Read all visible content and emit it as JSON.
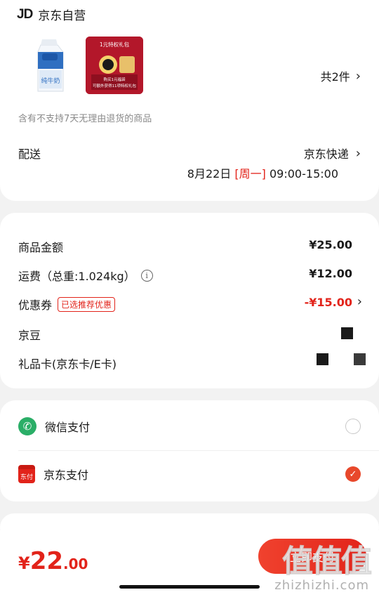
{
  "shop": {
    "logo": "JD",
    "name": "京东自营"
  },
  "items": {
    "thumbnails": [
      {
        "icon": "milk-carton-image",
        "label": "纯牛奶"
      },
      {
        "icon": "gift-pack-image",
        "title": "1元特权礼包",
        "line1": "购买1元福袋",
        "line2": "可额外获得11项特权礼包"
      }
    ],
    "count_label": "共2件",
    "return_note": "含有不支持7天无理由退货的商品"
  },
  "delivery": {
    "label": "配送",
    "method": "京东快递",
    "date": "8月22日",
    "weekday": "[周一]",
    "time": "09:00-15:00"
  },
  "price": {
    "goods_label": "商品金额",
    "goods_value": "¥25.00",
    "shipping_label": "运费（总重:1.024kg）",
    "shipping_value": "¥12.00",
    "coupon_label": "优惠券",
    "coupon_tag": "已选推荐优惠",
    "coupon_value": "-¥15.00",
    "jingdou_label": "京豆",
    "giftcard_label": "礼品卡(京东卡/E卡)"
  },
  "payment": {
    "wechat_label": "微信支付",
    "jdpay_label": "京东支付",
    "jdpay_icon_text": "东付",
    "selected": "京东支付"
  },
  "bottom": {
    "currency": "¥",
    "total_int": "22",
    "total_dec": ".00",
    "pay_button": "立即支付",
    "watermark": "值值值",
    "watermark_url": "zhizhizhi.com"
  },
  "colors": {
    "accent": "#e2231a",
    "wechat": "#2aae67",
    "background": "#f2f2f2"
  }
}
